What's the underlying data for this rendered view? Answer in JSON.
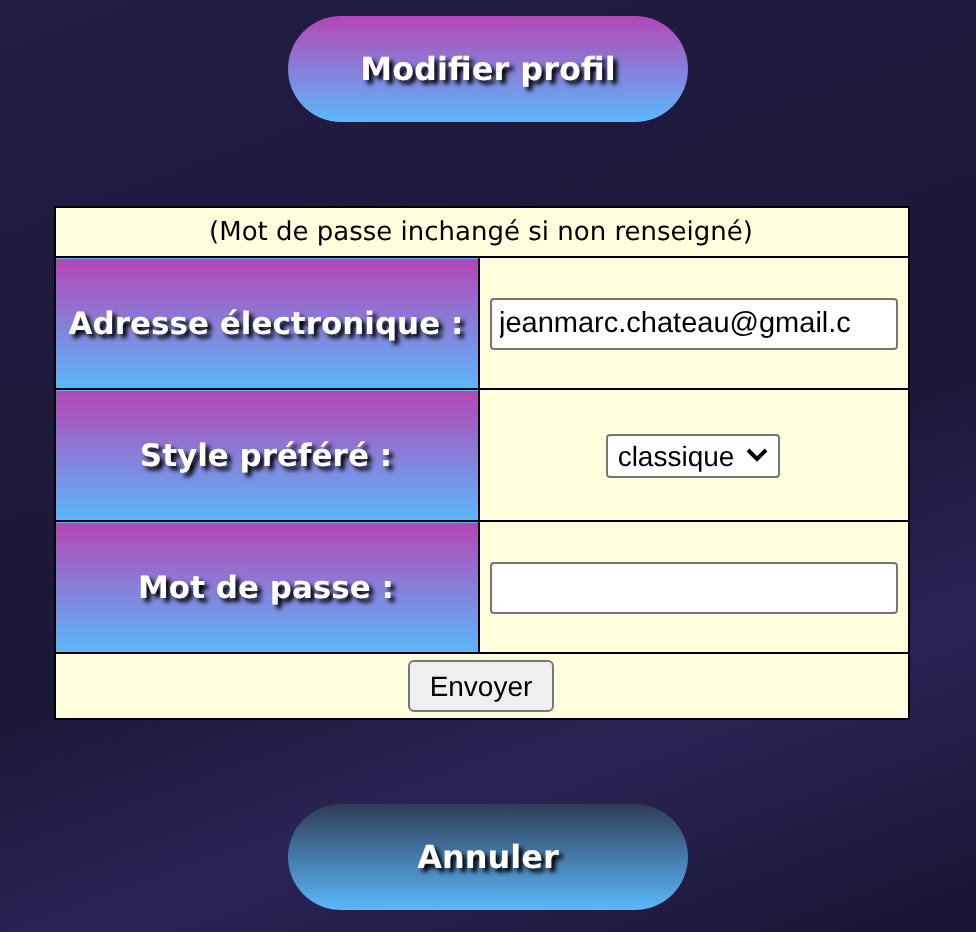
{
  "title_button": "Modifier profil",
  "form": {
    "note": "(Mot de passe inchangé si non renseigné)",
    "rows": [
      {
        "label": "Adresse électronique :",
        "kind": "text",
        "value": "jeanmarc.chateau@gmail.c"
      },
      {
        "label": "Style préféré :",
        "kind": "select",
        "value": "classique"
      },
      {
        "label": "Mot de passe :",
        "kind": "password",
        "value": ""
      }
    ],
    "submit": "Envoyer"
  },
  "cancel_button": "Annuler"
}
